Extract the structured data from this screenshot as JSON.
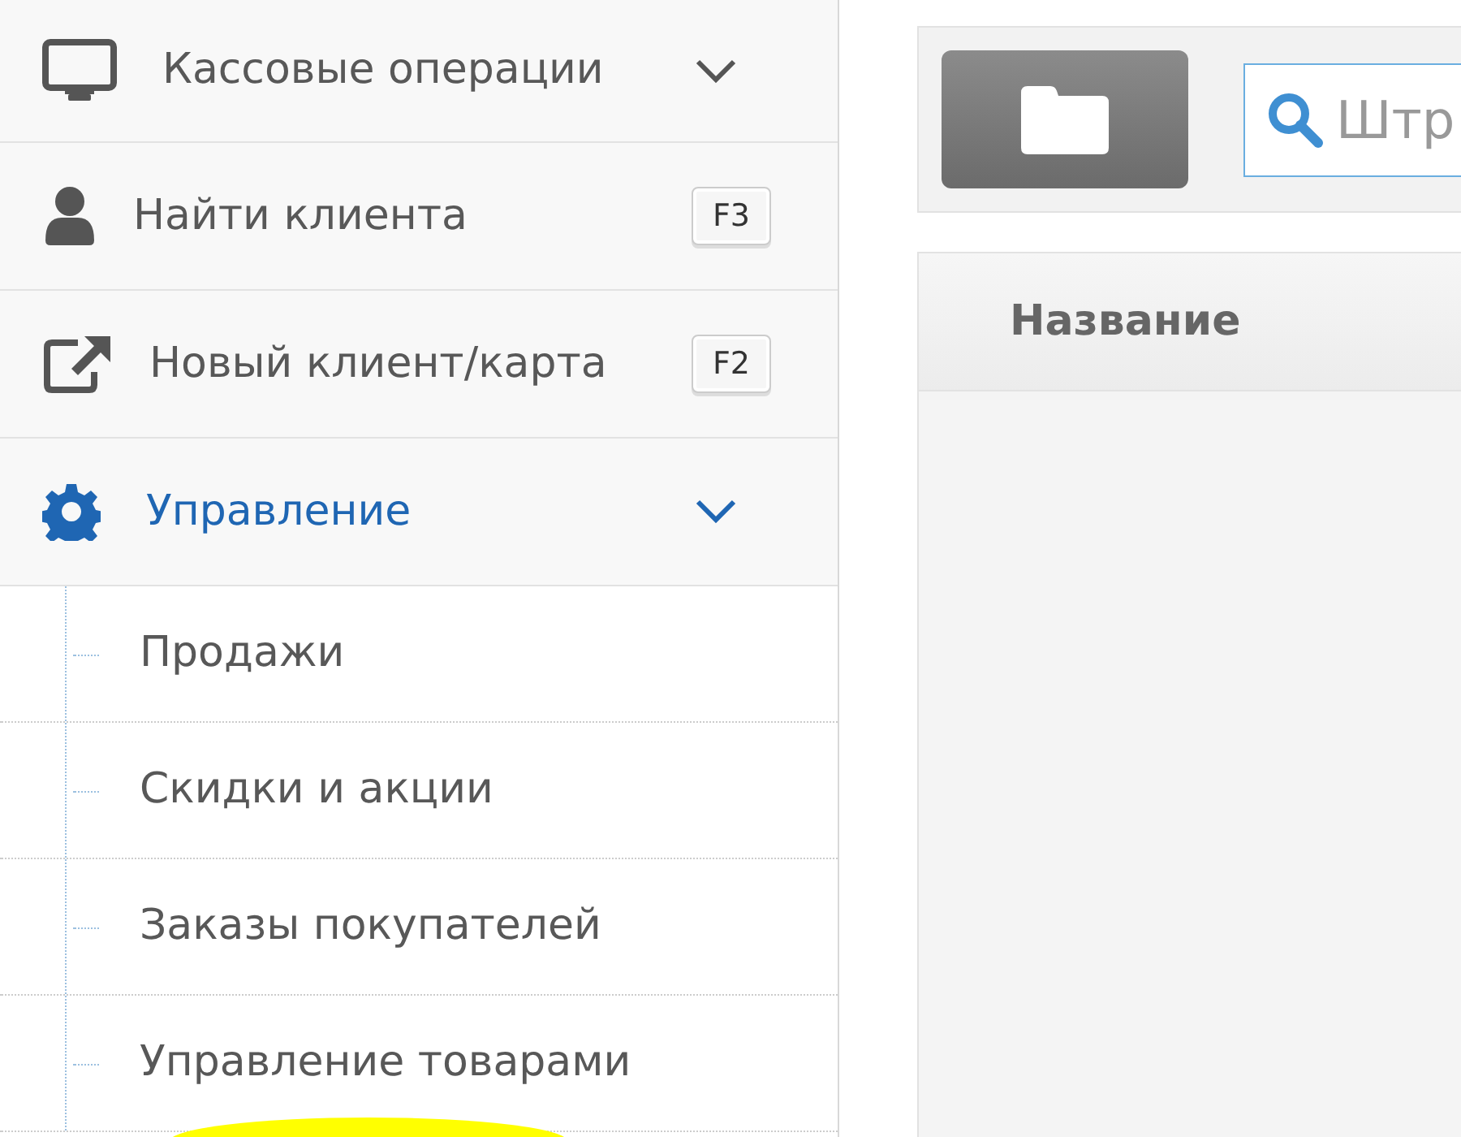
{
  "sidebar": {
    "items": [
      {
        "label": "Кассовые операции",
        "kind": "group",
        "selected": false
      },
      {
        "label": "Найти клиента",
        "kind": "action",
        "shortcut": "F3",
        "selected": false
      },
      {
        "label": "Новый клиент/карта",
        "kind": "action",
        "shortcut": "F2",
        "selected": false
      },
      {
        "label": "Управление",
        "kind": "group",
        "selected": true,
        "children": [
          {
            "label": "Продажи"
          },
          {
            "label": "Скидки и акции"
          },
          {
            "label": "Заказы покупателей"
          },
          {
            "label": "Управление товарами"
          }
        ]
      }
    ]
  },
  "toolbar": {
    "search": {
      "placeholder": "Штр"
    }
  },
  "table": {
    "columns": [
      "Название"
    ]
  }
}
